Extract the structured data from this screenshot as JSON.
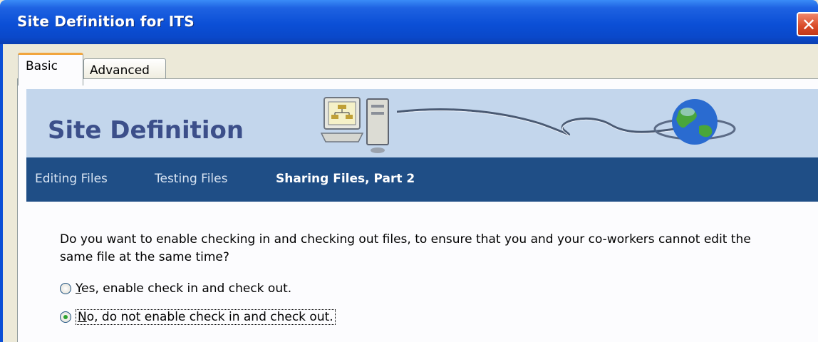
{
  "window": {
    "title": "Site Definition for ITS",
    "close_glyph": "✕"
  },
  "tabs": [
    {
      "label": "Basic",
      "selected": true
    },
    {
      "label": "Advanced",
      "selected": false
    }
  ],
  "banner": {
    "title": "Site Definition",
    "icons": [
      "computer-icon",
      "globe-icon"
    ]
  },
  "steps": [
    {
      "label": "Editing Files",
      "active": false
    },
    {
      "label": "Testing Files",
      "active": false
    },
    {
      "label": "Sharing Files, Part 2",
      "active": true
    }
  ],
  "question": "Do you want to enable checking in and checking out files, to ensure that you and your co-workers cannot edit the same file at the same time?",
  "options": [
    {
      "mnemonic": "Y",
      "rest": "es, enable check in and check out.",
      "selected": false
    },
    {
      "mnemonic": "N",
      "rest": "o, do not enable check in and check out.",
      "selected": true
    }
  ],
  "colors": {
    "titlebar": "#0b4fd6",
    "banner": "#c3d6ec",
    "navbar": "#1f4e86",
    "tab_highlight": "#f1a53d",
    "radio_dot": "#2ea12e"
  }
}
